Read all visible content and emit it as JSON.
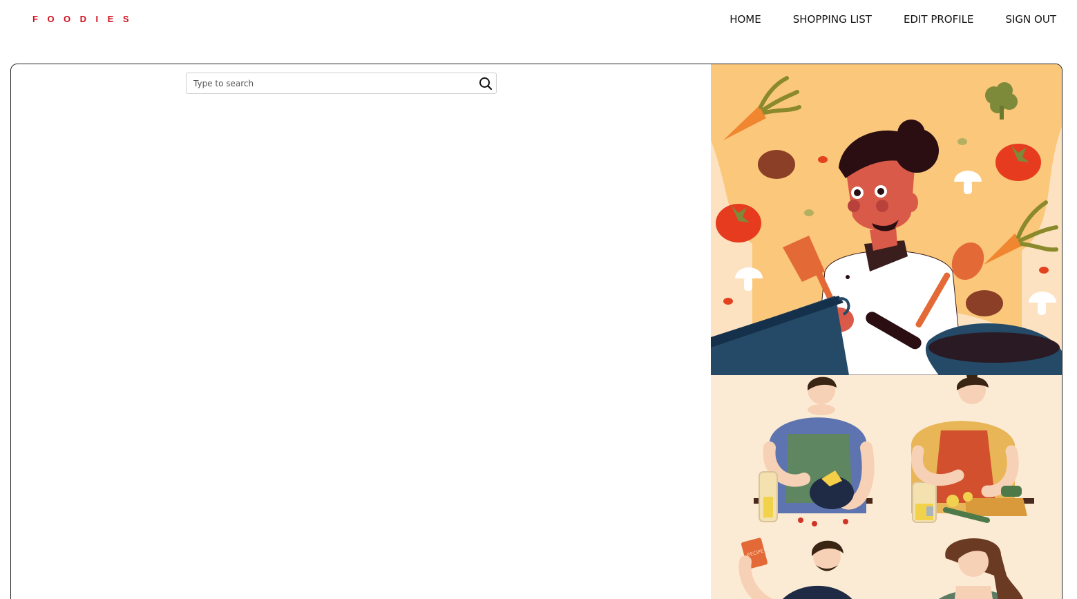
{
  "brand": {
    "logo": "FOODIES",
    "color": "#d10f1c"
  },
  "nav": {
    "items": [
      {
        "label": "HOME",
        "name": "nav-home"
      },
      {
        "label": "SHOPPING LIST",
        "name": "nav-shopping-list"
      },
      {
        "label": "EDIT PROFILE",
        "name": "nav-edit-profile"
      },
      {
        "label": "SIGN OUT",
        "name": "nav-sign-out"
      }
    ]
  },
  "search": {
    "placeholder": "Type to search",
    "value": "",
    "icon": "search-icon"
  },
  "illustrations": {
    "top": "chef-cooking-illustration",
    "bottom": "home-cooks-illustration",
    "recipe_card_text": "RECIPE"
  },
  "colors": {
    "accent": "#d10f1c",
    "top_bg": "#fbc77a",
    "bottom_bg": "#fcebd4",
    "pot": "#244a68"
  }
}
